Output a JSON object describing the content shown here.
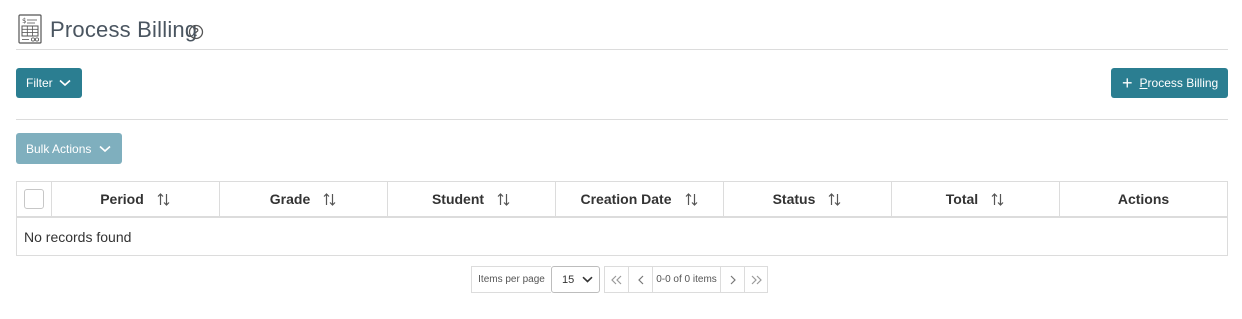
{
  "header": {
    "title": "Process Billing",
    "page_icon": "billing-calculator-icon",
    "help_icon": "help-circle-icon"
  },
  "toolbar": {
    "filter_label": "Filter",
    "process_label_u": "P",
    "process_label_rest": "rocess Billing",
    "bulk_label": "Bulk Actions"
  },
  "table": {
    "columns": [
      "Period",
      "Grade",
      "Student",
      "Creation Date",
      "Status",
      "Total",
      "Actions"
    ],
    "empty_message": "No records found"
  },
  "pager": {
    "items_per_page_label": "Items per page",
    "page_size": "15",
    "range_label": "0-0 of 0 items"
  },
  "colors": {
    "primary": "#2b7e91",
    "primary_disabled": "#7fafbe",
    "border": "#dcdcdc"
  }
}
